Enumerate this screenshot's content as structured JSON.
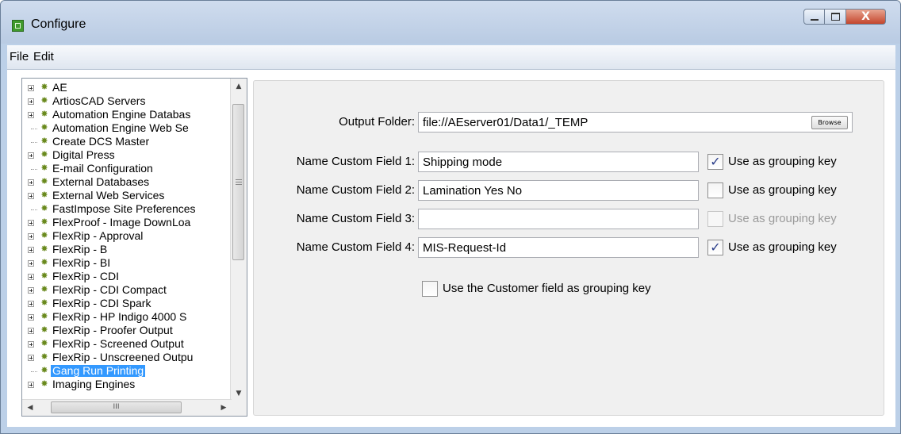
{
  "window": {
    "title": "Configure",
    "min_icon": "minimize-icon",
    "max_icon": "maximize-icon",
    "close_label": "X"
  },
  "menu": {
    "file": "File",
    "edit": "Edit"
  },
  "tree": {
    "items": [
      {
        "label": "AE",
        "expandable": true
      },
      {
        "label": "ArtiosCAD Servers",
        "expandable": true
      },
      {
        "label": "Automation Engine Databas",
        "expandable": true
      },
      {
        "label": "Automation Engine Web Se",
        "expandable": false
      },
      {
        "label": "Create DCS Master",
        "expandable": false
      },
      {
        "label": "Digital Press",
        "expandable": true
      },
      {
        "label": "E-mail Configuration",
        "expandable": false
      },
      {
        "label": "External Databases",
        "expandable": true
      },
      {
        "label": "External Web Services",
        "expandable": true
      },
      {
        "label": "FastImpose Site Preferences",
        "expandable": false
      },
      {
        "label": "FlexProof - Image DownLoa",
        "expandable": true
      },
      {
        "label": "FlexRip - Approval",
        "expandable": true
      },
      {
        "label": "FlexRip - B",
        "expandable": true
      },
      {
        "label": "FlexRip - BI",
        "expandable": true
      },
      {
        "label": "FlexRip - CDI",
        "expandable": true
      },
      {
        "label": "FlexRip - CDI Compact",
        "expandable": true
      },
      {
        "label": "FlexRip - CDI Spark",
        "expandable": true
      },
      {
        "label": "FlexRip - HP Indigo 4000 S",
        "expandable": true
      },
      {
        "label": "FlexRip - Proofer Output",
        "expandable": true
      },
      {
        "label": "FlexRip - Screened Output",
        "expandable": true
      },
      {
        "label": "FlexRip - Unscreened Outpu",
        "expandable": true
      },
      {
        "label": "Gang Run Printing",
        "expandable": false,
        "selected": true
      },
      {
        "label": "Imaging Engines",
        "expandable": true
      }
    ],
    "hscroll_grip": "III"
  },
  "form": {
    "output_folder_label": "Output Folder:",
    "output_folder_value": "file://AEserver01/Data1/_TEMP",
    "browse_label": "Browse",
    "custom_fields": [
      {
        "label": "Name Custom Field 1:",
        "value": "Shipping mode",
        "grouping_label": "Use as grouping key",
        "checked": true,
        "enabled": true
      },
      {
        "label": "Name Custom Field 2:",
        "value": "Lamination Yes No",
        "grouping_label": "Use as grouping key",
        "checked": false,
        "enabled": true
      },
      {
        "label": "Name Custom Field 3:",
        "value": "",
        "grouping_label": "Use as grouping key",
        "checked": false,
        "enabled": false
      },
      {
        "label": "Name Custom Field 4:",
        "value": "MIS-Request-Id",
        "grouping_label": "Use as grouping key",
        "checked": true,
        "enabled": true
      }
    ],
    "customer_grouping_label": "Use the Customer field as grouping key",
    "customer_grouping_checked": false
  },
  "colors": {
    "selection": "#3399ff",
    "window_frame": "#bcd0e8",
    "close_button": "#c4452c"
  }
}
